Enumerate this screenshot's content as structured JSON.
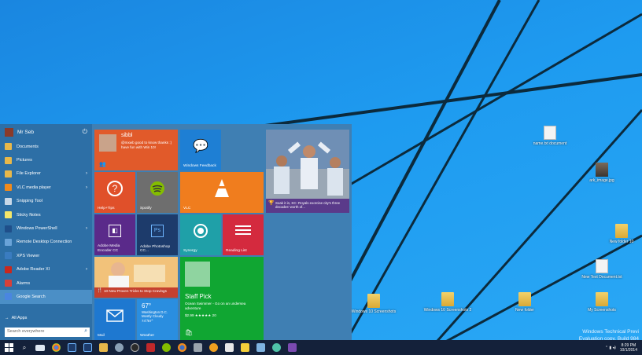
{
  "desktop": {
    "icons": [
      {
        "label": "name.txt document",
        "kind": "doc"
      },
      {
        "label": "ark_image.jpg",
        "kind": "photo"
      },
      {
        "label": "New folder 10",
        "kind": "folder"
      },
      {
        "label": "New Text Document.txt",
        "kind": "doc"
      },
      {
        "label": "Windows 10 Screenshots",
        "kind": "folder"
      },
      {
        "label": "Windows 10 Screenshots 2",
        "kind": "folder"
      },
      {
        "label": "New folder",
        "kind": "folder"
      },
      {
        "label": "My Screenshots",
        "kind": "folder"
      }
    ],
    "watermark": {
      "line1": "Windows Technical Previ",
      "line2": "Evaluation copy. Build 984"
    }
  },
  "start_menu": {
    "user_name": "Mr Seb",
    "apps": [
      {
        "label": "Documents",
        "icon": "folder-icon",
        "color": "#e8b84a",
        "arrow": false
      },
      {
        "label": "Pictures",
        "icon": "pictures-icon",
        "color": "#e8b84a",
        "arrow": false
      },
      {
        "label": "File Explorer",
        "icon": "file-explorer-icon",
        "color": "#e8b84a",
        "arrow": true
      },
      {
        "label": "VLC media player",
        "icon": "vlc-icon",
        "color": "#f08a1c",
        "arrow": true
      },
      {
        "label": "Snipping Tool",
        "icon": "scissors-icon",
        "color": "#c8d8e8",
        "arrow": false
      },
      {
        "label": "Sticky Notes",
        "icon": "note-icon",
        "color": "#f5e76a",
        "arrow": false
      },
      {
        "label": "Windows PowerShell",
        "icon": "powershell-icon",
        "color": "#1f4f8a",
        "arrow": true
      },
      {
        "label": "Remote Desktop Connection",
        "icon": "remote-desktop-icon",
        "color": "#6aa3d8",
        "arrow": false
      },
      {
        "label": "XPS Viewer",
        "icon": "xps-icon",
        "color": "#3a7cc0",
        "arrow": false
      },
      {
        "label": "Adobe Reader XI",
        "icon": "adobe-reader-icon",
        "color": "#c8281e",
        "arrow": true
      },
      {
        "label": "Alarms",
        "icon": "alarm-icon",
        "color": "#d6403a",
        "arrow": false
      },
      {
        "label": "Google Search",
        "icon": "google-icon",
        "color": "#4a86e0",
        "arrow": false
      }
    ],
    "all_apps": "All Apps",
    "search_placeholder": "Search everywhere",
    "tiles": {
      "people": {
        "name": "sibbl",
        "text": "@mxwb good to know thanks :) have fun with Win 10!"
      },
      "feedback": {
        "label": "Windows Feedback"
      },
      "help": {
        "label": "Help+Tips"
      },
      "spotify": {
        "label": "Spotify"
      },
      "vlc": {
        "label": "VLC"
      },
      "news": {
        "caption": "Soak it in, KC: Royals exorcise city's three decades' worth of..."
      },
      "media_encoder": {
        "label": "Adobe Media Encoder CC"
      },
      "photoshop": {
        "label": "Adobe Photoshop CC..."
      },
      "synergy": {
        "label": "Synergy"
      },
      "reading_list": {
        "label": "Reading List"
      },
      "food": {
        "caption": "10 New Proven Tricks to Stop Cravings"
      },
      "store": {
        "title": "Staff Pick",
        "desc": "Ocean Swimmer - Go on an undersea adventure",
        "price": "$2.99 ★★★★★ 20"
      },
      "mail": {
        "label": "Mail"
      },
      "weather": {
        "temp": "67°",
        "city": "Washington D.C.",
        "cond": "Mostly Cloudy",
        "range": "74°/57°",
        "label": "Weather"
      }
    }
  },
  "taskbar": {
    "time": "8:29 PM",
    "date": "10/1/2014"
  },
  "colors": {
    "accent": "#3f7fb3",
    "taskbar": "#14213a"
  }
}
